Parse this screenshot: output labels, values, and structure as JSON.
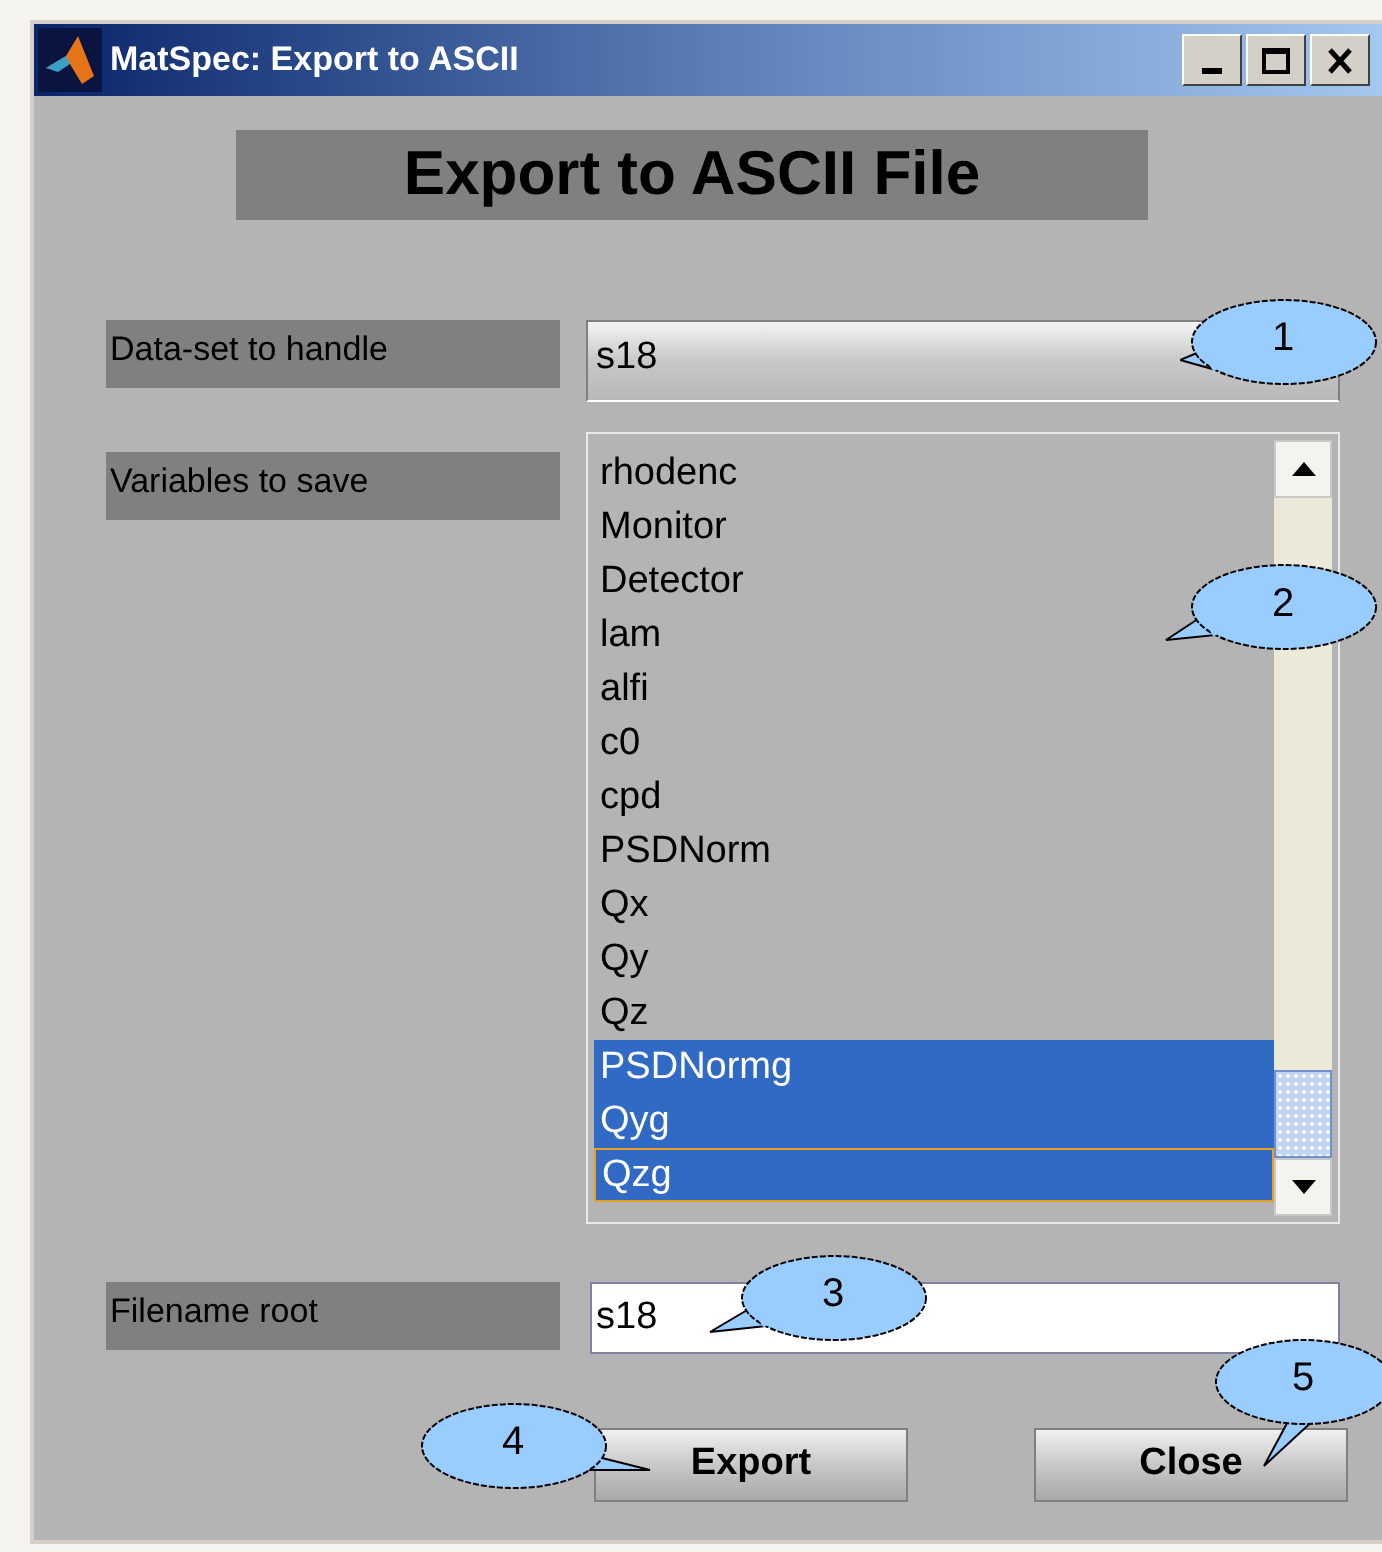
{
  "window": {
    "title": "MatSpec: Export to ASCII"
  },
  "heading": "Export to ASCII File",
  "dataset": {
    "label": "Data-set to handle",
    "value": "s18"
  },
  "variables": {
    "label": "Variables to save",
    "items": [
      {
        "text": "rhodenc",
        "selected": false,
        "focused": false
      },
      {
        "text": "Monitor",
        "selected": false,
        "focused": false
      },
      {
        "text": "Detector",
        "selected": false,
        "focused": false
      },
      {
        "text": "lam",
        "selected": false,
        "focused": false
      },
      {
        "text": "alfi",
        "selected": false,
        "focused": false
      },
      {
        "text": "c0",
        "selected": false,
        "focused": false
      },
      {
        "text": "cpd",
        "selected": false,
        "focused": false
      },
      {
        "text": "PSDNorm",
        "selected": false,
        "focused": false
      },
      {
        "text": "Qx",
        "selected": false,
        "focused": false
      },
      {
        "text": "Qy",
        "selected": false,
        "focused": false
      },
      {
        "text": "Qz",
        "selected": false,
        "focused": false
      },
      {
        "text": "PSDNormg",
        "selected": true,
        "focused": false
      },
      {
        "text": "Qyg",
        "selected": true,
        "focused": false
      },
      {
        "text": "Qzg",
        "selected": true,
        "focused": true
      }
    ]
  },
  "filename": {
    "label": "Filename root",
    "value": "s18"
  },
  "buttons": [
    "Export",
    "Close"
  ],
  "callouts": [
    "1",
    "2",
    "3",
    "4",
    "5"
  ]
}
